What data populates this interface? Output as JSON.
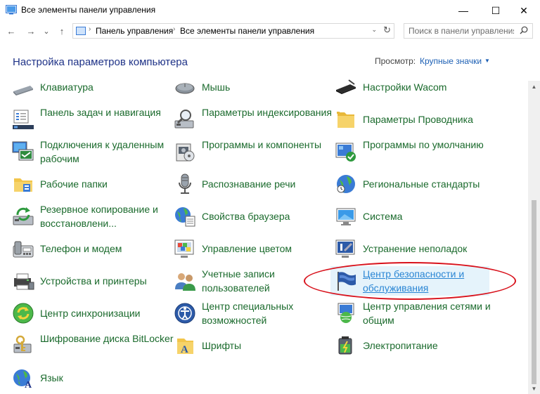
{
  "window": {
    "title": "Все элементы панели управления",
    "min": "—",
    "max": "☐",
    "close": "✕"
  },
  "nav": {
    "back": "←",
    "forward": "→",
    "recent": "⌄",
    "up": "↑",
    "breadcrumbs": [
      "Панель управления",
      "Все элементы панели управления"
    ],
    "separator": "›",
    "dropdown": "⌄",
    "refresh": "↻",
    "search_placeholder": "Поиск в панели управления"
  },
  "header": {
    "title": "Настройка параметров компьютера",
    "view_label": "Просмотр:",
    "view_value": "Крупные значки",
    "view_caret": "▼"
  },
  "scrollbar": {
    "up": "▲",
    "down": "▼"
  },
  "columns": [
    {
      "items": [
        {
          "label": "Клавиатура",
          "icon": "keyboard-icon"
        },
        {
          "label": "Панель задач и навигация",
          "icon": "taskbar-icon"
        },
        {
          "label": "Подключения к удаленным рабочим",
          "icon": "remote-desktop-icon"
        },
        {
          "label": "Рабочие папки",
          "icon": "work-folders-icon"
        },
        {
          "label": "Резервное копирование и восстановлени...",
          "icon": "backup-icon"
        },
        {
          "label": "Телефон и модем",
          "icon": "phone-modem-icon"
        },
        {
          "label": "Устройства и принтеры",
          "icon": "devices-printers-icon"
        },
        {
          "label": "Центр синхронизации",
          "icon": "sync-center-icon"
        },
        {
          "label": "Шифрование диска BitLocker",
          "icon": "bitlocker-icon"
        },
        {
          "label": "Язык",
          "icon": "language-icon"
        }
      ]
    },
    {
      "items": [
        {
          "label": "Мышь",
          "icon": "mouse-icon"
        },
        {
          "label": "Параметры индексирования",
          "icon": "indexing-icon"
        },
        {
          "label": "Программы и компоненты",
          "icon": "programs-icon"
        },
        {
          "label": "Распознавание речи",
          "icon": "microphone-icon"
        },
        {
          "label": "Свойства браузера",
          "icon": "internet-options-icon"
        },
        {
          "label": "Управление цветом",
          "icon": "color-management-icon"
        },
        {
          "label": "Учетные записи пользователей",
          "icon": "user-accounts-icon"
        },
        {
          "label": "Центр специальных возможностей",
          "icon": "accessibility-icon"
        },
        {
          "label": "Шрифты",
          "icon": "fonts-icon"
        }
      ]
    },
    {
      "items": [
        {
          "label": "Настройки Wacom",
          "icon": "wacom-icon"
        },
        {
          "label": "Параметры Проводника",
          "icon": "explorer-options-icon"
        },
        {
          "label": "Программы по умолчанию",
          "icon": "default-programs-icon"
        },
        {
          "label": "Региональные стандарты",
          "icon": "region-icon"
        },
        {
          "label": "Система",
          "icon": "system-icon"
        },
        {
          "label": "Устранение неполадок",
          "icon": "troubleshooting-icon"
        },
        {
          "label": "Центр безопасности и обслуживания",
          "icon": "security-maintenance-icon"
        },
        {
          "label": "Центр управления сетями и общим",
          "icon": "network-center-icon"
        },
        {
          "label": "Электропитание",
          "icon": "power-options-icon"
        }
      ]
    }
  ],
  "highlight_color": "#d8121c",
  "link_color": "#1a6a2c"
}
